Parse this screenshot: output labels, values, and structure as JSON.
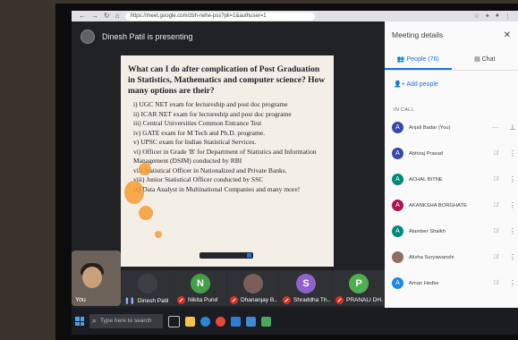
{
  "browser": {
    "url": "https://meet.google.com/zbh-rwhe-pss?pli=1&authuser=1"
  },
  "presenter_bar": {
    "text": "Dinesh Patil is presenting"
  },
  "slide": {
    "question": "What can I do after complication of Post Graduation in Statistics, Mathematics and computer science? How many options are their?",
    "items": [
      "i) UGC NET exam for lectureship and post doc programe",
      "ii) ICAR NET exam for lectureship and post doc programe",
      "iii) Central Universities Common Entrance Test",
      "iv) GATE exam for M Tech and Ph.D. programe.",
      "v) UPSC exam for Indian Statistical Services.",
      "vi) Officer in Grade 'B' for Department of Statistics and Information Management (DSIM) conducted by RBI",
      "vii) Statistical Officer in Nationalized and Private Banks.",
      "viii) Junior Statistical Officer conducted by SSC",
      "ix) Data Analyst in Multinational Companies and many more!"
    ]
  },
  "self_tile": {
    "label": "You"
  },
  "participants_strip": [
    {
      "initial": "",
      "name": "Dinesh Patil",
      "color": "#3c4043",
      "muted": false
    },
    {
      "initial": "N",
      "name": "Nikita Pund",
      "color": "#43a047",
      "muted": true
    },
    {
      "initial": "",
      "name": "Dhananjay B...",
      "color": "#7b5e57",
      "muted": true
    },
    {
      "initial": "S",
      "name": "Shraddha Th...",
      "color": "#8e63ce",
      "muted": true
    },
    {
      "initial": "P",
      "name": "PRANALI DH...",
      "color": "#4caf50",
      "muted": true
    }
  ],
  "taskbar": {
    "search_placeholder": "Type here to search"
  },
  "panel": {
    "title": "Meeting details",
    "tabs": [
      {
        "label": "People (76)",
        "active": true
      },
      {
        "label": "Chat",
        "active": false
      }
    ],
    "add_people": "Add people",
    "section": "IN CALL",
    "people": [
      {
        "initial": "A",
        "name": "Anjali Badar (You)",
        "color": "#3949ab"
      },
      {
        "initial": "A",
        "name": "Abhiraj Prasad",
        "color": "#3949ab"
      },
      {
        "initial": "A",
        "name": "ACHAL BITNE",
        "color": "#00897b"
      },
      {
        "initial": "A",
        "name": "AKANKSHA BORGHATE",
        "color": "#ad1457"
      },
      {
        "initial": "A",
        "name": "Alamber Shaikh",
        "color": "#00897b"
      },
      {
        "initial": "",
        "name": "Alisha Suryawanshi",
        "color": "#8d6e63"
      },
      {
        "initial": "A",
        "name": "Aman Hedke",
        "color": "#1e88e5"
      }
    ]
  }
}
